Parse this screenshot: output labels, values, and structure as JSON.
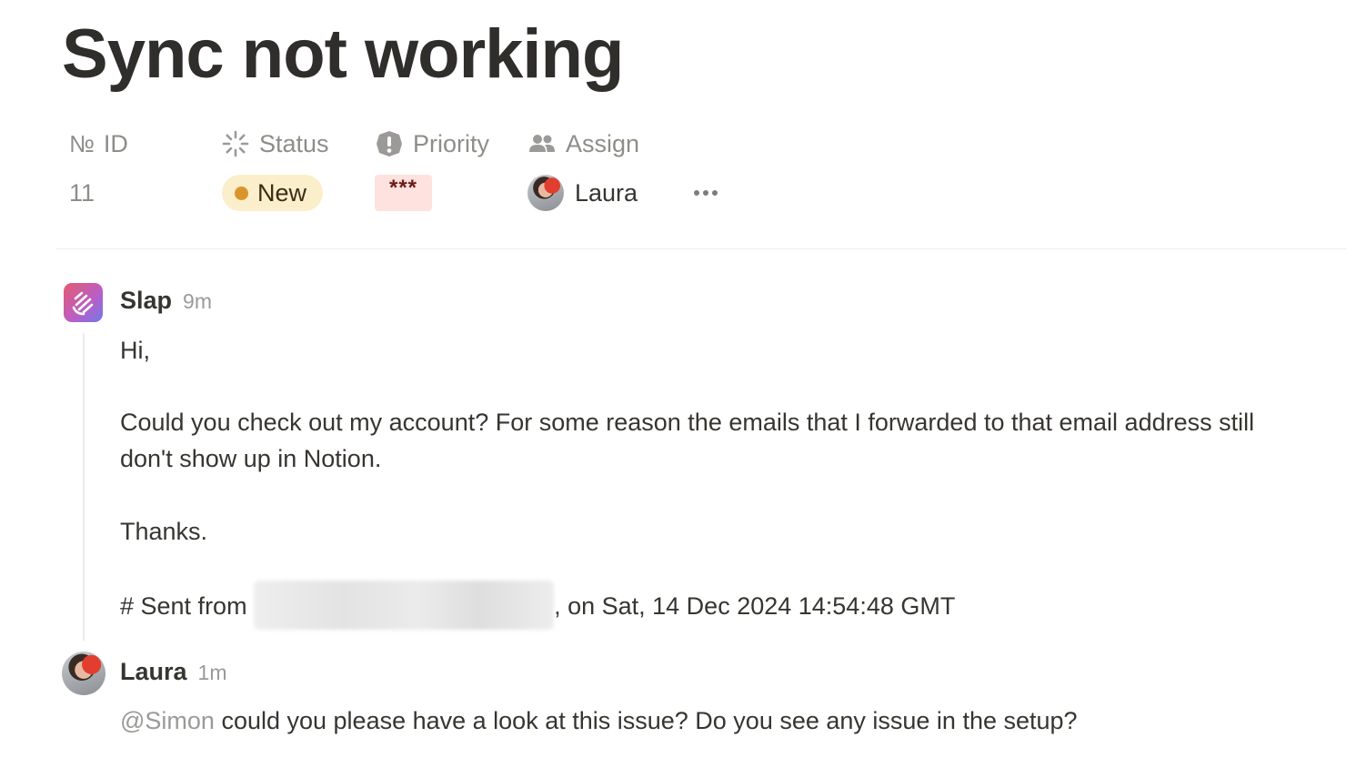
{
  "page": {
    "title": "Sync not working"
  },
  "properties": {
    "id": {
      "label": "ID",
      "icon": "number-sign-icon",
      "value": "11"
    },
    "status": {
      "label": "Status",
      "icon": "status-spinner-icon",
      "value": "New",
      "color": "#d9952b",
      "background": "#fbeecb"
    },
    "priority": {
      "label": "Priority",
      "icon": "priority-alert-icon",
      "value": "***",
      "color": "#6d1a13",
      "background": "#fde2df"
    },
    "assign": {
      "label": "Assign",
      "icon": "people-icon",
      "value": "Laura"
    },
    "more_icon": "more-horizontal-icon"
  },
  "comments": [
    {
      "author": "Slap",
      "time": "9m",
      "icon": "slap-app-icon",
      "lines": [
        "Hi,",
        "Could you check out my account? For some reason the emails that I forwarded to that email address still",
        "don't show up in Notion.",
        "Thanks.",
        "# Sent from",
        ", on Sat, 14 Dec 2024 14:54:48 GMT"
      ]
    },
    {
      "author": "Laura",
      "time": "1m",
      "icon": "avatar",
      "mention": "@Simon",
      "text": " could you please have a look at this issue? Do you see any issue in the setup?"
    }
  ]
}
